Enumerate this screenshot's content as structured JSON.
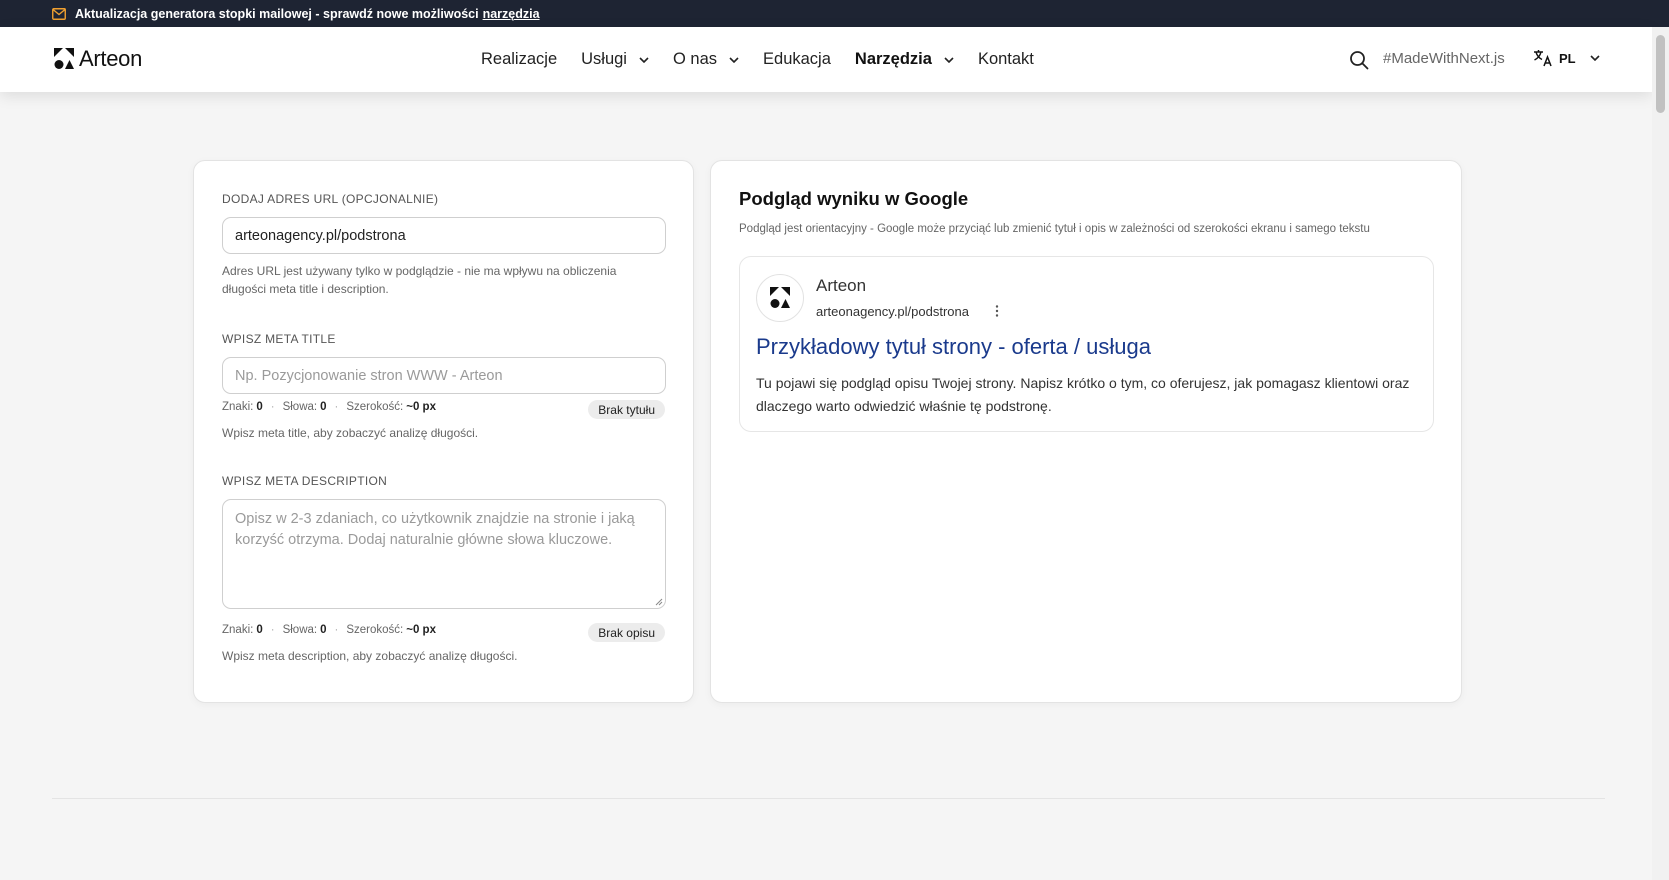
{
  "announcement": {
    "text": "Aktualizacja generatora stopki mailowej - sprawdź nowe możliwości",
    "link": "narzędzia"
  },
  "header": {
    "brand": "Arteon",
    "nav": [
      {
        "label": "Realizacje",
        "dropdown": false
      },
      {
        "label": "Usługi",
        "dropdown": true
      },
      {
        "label": "O nas",
        "dropdown": true
      },
      {
        "label": "Edukacja",
        "dropdown": false
      },
      {
        "label": "Narzędzia",
        "dropdown": true,
        "active": true
      },
      {
        "label": "Kontakt",
        "dropdown": false
      }
    ],
    "hashtag": "#MadeWithNext.js",
    "language": "PL"
  },
  "form": {
    "url_label": "DODAJ ADRES URL (OPCJONALNIE)",
    "url_value": "arteonagency.pl/podstrona",
    "url_help": "Adres URL jest używany tylko w podglądzie - nie ma wpływu na obliczenia długości meta title i description.",
    "title_label": "WPISZ META TITLE",
    "title_placeholder": "Np. Pozycjonowanie stron WWW - Arteon",
    "title_stats": {
      "chars_label": "Znaki:",
      "chars": "0",
      "words_label": "Słowa:",
      "words": "0",
      "width_label": "Szerokość:",
      "width": "~0 px"
    },
    "title_badge": "Brak tytułu",
    "title_help": "Wpisz meta title, aby zobaczyć analizę długości.",
    "desc_label": "WPISZ META DESCRIPTION",
    "desc_placeholder": "Opisz w 2-3 zdaniach, co użytkownik znajdzie na stronie i jaką korzyść otrzyma. Dodaj naturalnie główne słowa kluczowe.",
    "desc_stats": {
      "chars_label": "Znaki:",
      "chars": "0",
      "words_label": "Słowa:",
      "words": "0",
      "width_label": "Szerokość:",
      "width": "~0 px"
    },
    "desc_badge": "Brak opisu",
    "desc_help": "Wpisz meta description, aby zobaczyć analizę długości."
  },
  "preview": {
    "title": "Podgląd wyniku w Google",
    "subtitle": "Podgląd jest orientacyjny - Google może przyciąć lub zmienić tytuł i opis w zależności od szerokości ekranu i samego tekstu",
    "site_name": "Arteon",
    "url": "arteonagency.pl/podstrona",
    "result_title": "Przykładowy tytuł strony - oferta / usługa",
    "result_desc": "Tu pojawi się podgląd opisu Twojej strony. Napisz krótko o tym, co oferujesz, jak pomagasz klientowi oraz dlaczego warto odwiedzić właśnie tę podstronę."
  },
  "colors": {
    "link": "#1a3a8c",
    "topbar": "#1e2433",
    "accent_mail": "#f0a030"
  }
}
